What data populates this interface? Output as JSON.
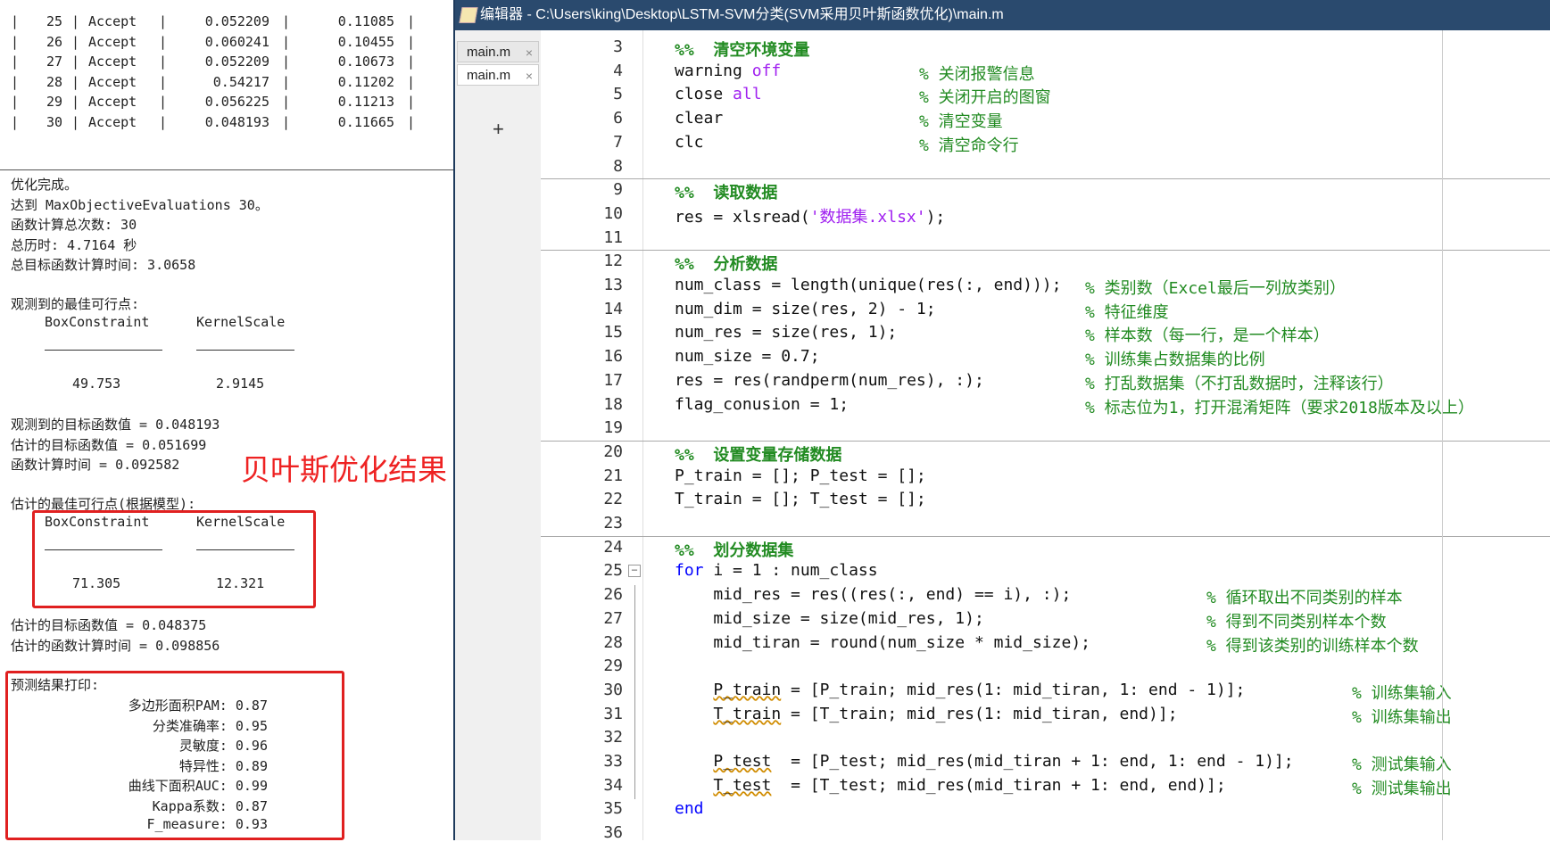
{
  "command_window": {
    "table_rows": [
      {
        "iter": "25",
        "result": "Accept",
        "obj": "0.052209",
        "best": "0.11085"
      },
      {
        "iter": "26",
        "result": "Accept",
        "obj": "0.060241",
        "best": "0.10455"
      },
      {
        "iter": "27",
        "result": "Accept",
        "obj": "0.052209",
        "best": "0.10673"
      },
      {
        "iter": "28",
        "result": "Accept",
        "obj": "0.54217",
        "best": "0.11202"
      },
      {
        "iter": "29",
        "result": "Accept",
        "obj": "0.056225",
        "best": "0.11213"
      },
      {
        "iter": "30",
        "result": "Accept",
        "obj": "0.048193",
        "best": "0.11665"
      }
    ],
    "summary": [
      "优化完成。",
      "达到 MaxObjectiveEvaluations 30。",
      "函数计算总次数: 30",
      "总历时: 4.7164 秒",
      "总目标函数计算时间: 3.0658"
    ],
    "observed_best_label": "观测到的最佳可行点:",
    "col_headers": [
      "BoxConstraint",
      "KernelScale"
    ],
    "observed_values": [
      "49.753",
      "2.9145"
    ],
    "observed_stats": [
      "观测到的目标函数值 = 0.048193",
      "估计的目标函数值 = 0.051699",
      "函数计算时间 = 0.092582"
    ],
    "annotation": "贝叶斯优化结果",
    "estimated_best_label": "估计的最佳可行点(根据模型):",
    "estimated_values": [
      "71.305",
      "12.321"
    ],
    "estimated_stats": [
      "估计的目标函数值 = 0.048375",
      "估计的函数计算时间 = 0.098856"
    ],
    "prediction_title": "预测结果打印:",
    "prediction_lines": [
      "多边形面积PAM: 0.87",
      "分类准确率: 0.95",
      "灵敏度: 0.96",
      "特异性: 0.89",
      "曲线下面积AUC: 0.99",
      "Kappa系数: 0.87",
      "F_measure: 0.93"
    ]
  },
  "editor": {
    "title": "编辑器 - C:\\Users\\king\\Desktop\\LSTM-SVM分类(SVM采用贝叶斯函数优化)\\main.m",
    "tabs": [
      "main.m",
      "main.m"
    ],
    "tab_close": "×",
    "add_tab": "+",
    "lines": [
      {
        "n": "3",
        "code": "",
        "cm": "%%  清空环境变量"
      },
      {
        "n": "4",
        "code": "warning ",
        "kw2": "off",
        "cm2": "% 关闭报警信息"
      },
      {
        "n": "5",
        "code": "close ",
        "kw2": "all",
        "cm2": "% 关闭开启的图窗"
      },
      {
        "n": "6",
        "code": "clear",
        "cm2": "% 清空变量"
      },
      {
        "n": "7",
        "code": "clc",
        "cm2": "% 清空命令行"
      },
      {
        "n": "8",
        "code": ""
      },
      {
        "n": "9",
        "code": "",
        "cm": "%%  读取数据"
      },
      {
        "n": "10",
        "code": "res = xlsread(",
        "str": "'数据集.xlsx'",
        "tail": ");"
      },
      {
        "n": "11",
        "code": ""
      },
      {
        "n": "12",
        "code": "",
        "cm": "%%  分析数据"
      },
      {
        "n": "13",
        "code": "num_class = length(unique(res(:, end)));",
        "cm3": "% 类别数（Excel最后一列放类别）"
      },
      {
        "n": "14",
        "code": "num_dim = size(res, 2) - 1;",
        "cm3": "% 特征维度"
      },
      {
        "n": "15",
        "code": "num_res = size(res, 1);",
        "cm3": "% 样本数（每一行，是一个样本）"
      },
      {
        "n": "16",
        "code": "num_size = 0.7;",
        "cm3": "% 训练集占数据集的比例"
      },
      {
        "n": "17",
        "code": "res = res(randperm(num_res), :);",
        "cm3": "% 打乱数据集（不打乱数据时，注释该行）"
      },
      {
        "n": "18",
        "code": "flag_conusion = 1;",
        "cm3": "% 标志位为1，打开混淆矩阵（要求2018版本及以上）"
      },
      {
        "n": "19",
        "code": ""
      },
      {
        "n": "20",
        "code": "",
        "cm": "%%  设置变量存储数据"
      },
      {
        "n": "21",
        "code": "P_train = []; P_test = [];"
      },
      {
        "n": "22",
        "code": "T_train = []; T_test = [];"
      },
      {
        "n": "23",
        "code": ""
      },
      {
        "n": "24",
        "code": "",
        "cm": "%%  划分数据集"
      },
      {
        "n": "25",
        "kw": "for",
        "code": " i = 1 : num_class"
      },
      {
        "n": "26",
        "code": "    mid_res = res((res(:, end) == i), :);",
        "cm4": "% 循环取出不同类别的样本"
      },
      {
        "n": "27",
        "code": "    mid_size = size(mid_res, 1);",
        "cm4": "% 得到不同类别样本个数"
      },
      {
        "n": "28",
        "code": "    mid_tiran = round(num_size * mid_size);",
        "cm4": "% 得到该类别的训练样本个数"
      },
      {
        "n": "29",
        "code": ""
      },
      {
        "n": "30",
        "code": "    P_train = [P_train; mid_res(1: mid_tiran, 1: end - 1)];",
        "cm5": "% 训练集输入"
      },
      {
        "n": "31",
        "code": "    T_train = [T_train; mid_res(1: mid_tiran, end)];",
        "cm5": "% 训练集输出"
      },
      {
        "n": "32",
        "code": ""
      },
      {
        "n": "33",
        "code": "    P_test  = [P_test; mid_res(mid_tiran + 1: end, 1: end - 1)];",
        "cm5": "% 测试集输入"
      },
      {
        "n": "34",
        "code": "    T_test  = [T_test; mid_res(mid_tiran + 1: end, end)];",
        "cm5": "% 测试集输出"
      },
      {
        "n": "35",
        "kw": "end",
        "code": ""
      },
      {
        "n": "36",
        "code": ""
      }
    ]
  },
  "colors": {
    "titlebar": "#2a4a6e",
    "keyword": "#0000ff",
    "string": "#a020f0",
    "comment": "#228b22",
    "annotation": "#ee2222"
  }
}
